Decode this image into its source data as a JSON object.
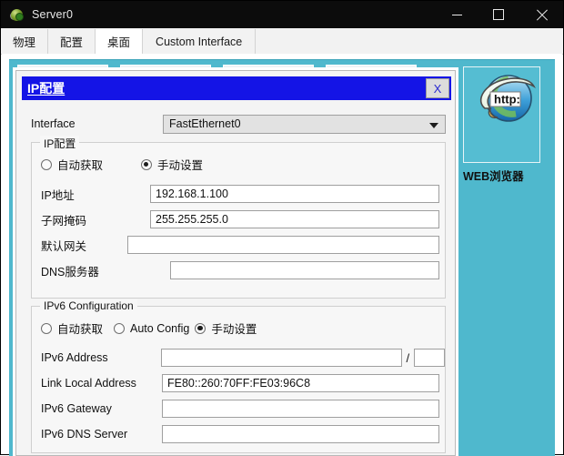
{
  "window": {
    "title": "Server0",
    "icon": "server-globe-icon",
    "buttons": {
      "minimize": "minimize-icon",
      "maximize": "maximize-icon",
      "close": "close-icon"
    }
  },
  "tabs": [
    {
      "label": "物理",
      "name": "tab-physical",
      "active": false
    },
    {
      "label": "配置",
      "name": "tab-config",
      "active": false
    },
    {
      "label": "桌面",
      "name": "tab-desktop",
      "active": true
    },
    {
      "label": "Custom Interface",
      "name": "tab-custom-interface",
      "active": false
    }
  ],
  "desktop": {
    "browser_tile": {
      "label": "WEB浏览器",
      "icon": "web-browser-globe-icon",
      "icon_text": "http:"
    }
  },
  "dialog": {
    "title": "IP配置",
    "close_label": "X",
    "interface": {
      "label": "Interface",
      "value": "FastEthernet0",
      "options": [
        "FastEthernet0"
      ]
    },
    "ipv4": {
      "group_title": "IP配置",
      "modes": [
        {
          "label": "自动获取",
          "selected": false
        },
        {
          "label": "手动设置",
          "selected": true
        }
      ],
      "fields": [
        {
          "label": "IP地址",
          "value": "192.168.1.100",
          "placeholder": ""
        },
        {
          "label": "子网掩码",
          "value": "255.255.255.0",
          "placeholder": ""
        },
        {
          "label": "默认网关",
          "value": "",
          "placeholder": ""
        },
        {
          "label": "DNS服务器",
          "value": "",
          "placeholder": ""
        }
      ]
    },
    "ipv6": {
      "group_title": "IPv6 Configuration",
      "modes": [
        {
          "label": "自动获取",
          "selected": false
        },
        {
          "label": "Auto Config",
          "selected": false
        },
        {
          "label": "手动设置",
          "selected": true
        }
      ],
      "address": {
        "label": "IPv6 Address",
        "value": "",
        "prefix": "",
        "separator": "/"
      },
      "fields": [
        {
          "label": "Link Local Address",
          "value": "FE80::260:70FF:FE03:96C8",
          "placeholder": ""
        },
        {
          "label": "IPv6 Gateway",
          "value": "",
          "placeholder": ""
        },
        {
          "label": "IPv6 DNS Server",
          "value": "",
          "placeholder": ""
        }
      ]
    }
  },
  "colors": {
    "titlebar": "#0c0c0c",
    "desktop_teal": "#4fb8cd",
    "dialog_title_blue": "#1414e6",
    "dialog_bg": "#f4f4f4"
  }
}
